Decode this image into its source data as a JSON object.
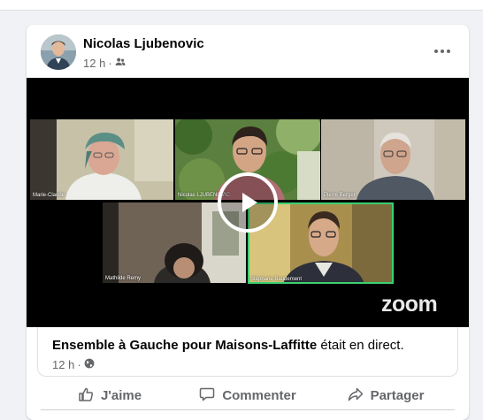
{
  "post": {
    "author": "Nicolas Ljubenovic",
    "time": "12 h",
    "audience_icon": "friends-icon",
    "more_icon": "more-options-icon"
  },
  "video": {
    "participants": [
      {
        "name": "Marie-Claude"
      },
      {
        "name": "Nicolas LJUBENOVIC"
      },
      {
        "name": "Pierre Berger"
      },
      {
        "name": "Mathilde Remy"
      },
      {
        "name": "Stéphane Baudement"
      }
    ],
    "active_speaker": "Stéphane Baudement",
    "logo": "zoom",
    "play_icon": "play-icon",
    "accent_color": "#3bd16f"
  },
  "live": {
    "page": "Ensemble à Gauche pour Maisons-Laffitte",
    "status": "était en direct.",
    "time": "12 h",
    "audience_icon": "globe-icon"
  },
  "actions": {
    "like": "J'aime",
    "comment": "Commenter",
    "share": "Partager"
  }
}
